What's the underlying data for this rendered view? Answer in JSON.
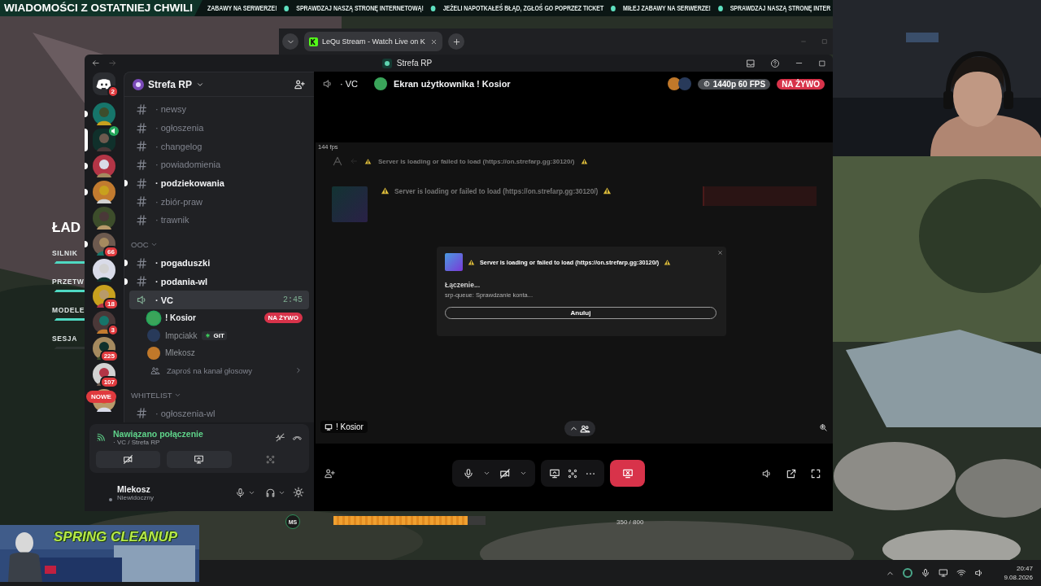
{
  "ticker": {
    "title": "WIADOMOŚCI Z OSTATNIEJ CHWILI",
    "items": [
      "ZABAWY NA SERWERZE!",
      "SPRAWDZAJ NASZĄ STRONĘ INTERNETOWĄ!",
      "JEŻELI NAPOTKAŁEŚ BŁĄD, ZGŁOŚ GO POPRZEZ TICKET",
      "MIŁEJ ZABAWY NA SERWERZE!",
      "SPRAWDZAJ NASZĄ STRONĘ INTER"
    ]
  },
  "browser": {
    "tabs": [
      {
        "title": "LeQu Stream - Watch Live on K",
        "selected": true
      }
    ]
  },
  "game_loading": {
    "title": "ŁAD",
    "steps": [
      {
        "label": "SILNIK",
        "done": true
      },
      {
        "label": "PRZETW",
        "done": true
      },
      {
        "label": "MODELE",
        "done": true
      },
      {
        "label": "SESJA",
        "done": false
      }
    ]
  },
  "discord": {
    "window_title": "Strefa RP",
    "home_badge": "2",
    "servers": [
      {
        "unread": true,
        "selected": false,
        "in_voice": false
      },
      {
        "unread": false,
        "selected": true,
        "in_voice": true
      },
      {
        "unread": true,
        "selected": false,
        "in_voice": false
      },
      {
        "unread": true,
        "selected": false,
        "in_voice": false
      },
      {
        "unread": false,
        "selected": false,
        "in_voice": false
      },
      {
        "badge": "66",
        "unread": true,
        "selected": false,
        "in_voice": false
      },
      {
        "unread": false,
        "selected": false,
        "in_voice": false
      },
      {
        "badge": "18",
        "unread": false,
        "selected": false,
        "in_voice": false
      },
      {
        "badge": "3",
        "unread": false,
        "selected": false,
        "in_voice": false
      },
      {
        "badge": "225",
        "unread": false,
        "selected": false,
        "in_voice": false
      },
      {
        "badge": "107",
        "unread": false,
        "selected": false,
        "in_voice": false
      },
      {
        "label": "NOWE",
        "unread": false,
        "selected": false,
        "in_voice": false
      }
    ],
    "server_name": "Strefa RP",
    "channels": [
      {
        "kind": "text",
        "name": "· newsy",
        "unread": false,
        "selected": false
      },
      {
        "kind": "text",
        "name": "· ogłoszenia",
        "unread": false,
        "selected": false
      },
      {
        "kind": "text",
        "name": "· changelog",
        "unread": false,
        "selected": false
      },
      {
        "kind": "text",
        "name": "· powiadomienia",
        "unread": false,
        "selected": false
      },
      {
        "kind": "text",
        "name": "· podziekowania",
        "unread": true,
        "selected": false
      },
      {
        "kind": "text",
        "name": "· zbiór-praw",
        "unread": false,
        "selected": false
      },
      {
        "kind": "text",
        "name": "· trawnik",
        "unread": false,
        "selected": false
      }
    ],
    "categories": [
      {
        "name": "OOC",
        "channels": [
          {
            "kind": "text",
            "name": "· pogaduszki",
            "unread": true,
            "selected": false
          },
          {
            "kind": "text",
            "name": "· podania-wl",
            "unread": true,
            "selected": false
          },
          {
            "kind": "voice",
            "name": "· VC",
            "unread": false,
            "selected": true,
            "time": "2:45",
            "members": [
              {
                "name": "! Kosior",
                "speaking": true,
                "live": "NA ŻYWO"
              },
              {
                "name": "Impciakk",
                "speaking": false,
                "tag": "GIT"
              },
              {
                "name": "Mlekosz",
                "speaking": false
              }
            ],
            "invite": "Zaproś na kanał głosowy"
          }
        ]
      },
      {
        "name": "WHITELIST",
        "channels": [
          {
            "kind": "text",
            "name": "· ogłoszenia-wl",
            "unread": false,
            "selected": false
          }
        ]
      }
    ],
    "voice_panel": {
      "status": "Nawiązano połączenie",
      "channel": "· VC / Strefa RP",
      "camera_on": false
    },
    "user": {
      "name": "Mlekosz",
      "status": "Niewidoczny",
      "mic_muted": false,
      "deafened": false
    }
  },
  "stream": {
    "channel": "· VC",
    "title": "Ekran użytkownika ! Kosior",
    "quality": "1440p 60 FPS",
    "live": "NA ŻYWO",
    "fps": "144 fps",
    "game": {
      "header": "Server is loading or failed to load (https://on.strefarp.gg:30120/)",
      "server_title": "Server is loading or failed to load (https://on.strefarp.gg:30120/)",
      "modal": {
        "title": "Server is loading or failed to load (https://on.strefarp.gg:30120/)",
        "status": "Łączenie...",
        "detail": "srp-queue: Sprawdzanie konta...",
        "button": "Anuluj"
      }
    },
    "streamer": "! Kosior",
    "participants_expanded": false,
    "controls": {
      "mic_muted": false,
      "camera_on": false
    }
  },
  "overlay": {
    "banner": "SPRING CLEANUP"
  },
  "hud": {
    "badge": "MS",
    "xp": "350 / 800",
    "level": 0.88
  },
  "taskbar": {
    "time": "20:47",
    "date": "9.08.2026"
  }
}
